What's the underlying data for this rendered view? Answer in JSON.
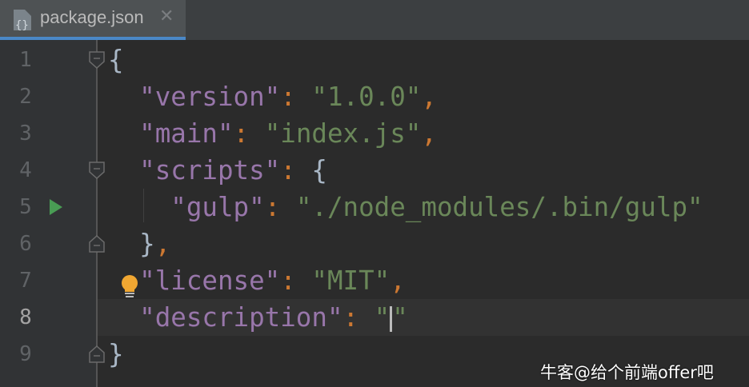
{
  "tab": {
    "title": "package.json",
    "icon": "json-file-icon",
    "close_icon": "close-icon",
    "close_glyph": "✕"
  },
  "line_numbers": [
    "1",
    "2",
    "3",
    "4",
    "5",
    "6",
    "7",
    "8",
    "9"
  ],
  "current_line": "8",
  "code": {
    "l1": {
      "brace": "{"
    },
    "l2": {
      "key": "\"version\"",
      "colon": ":",
      "value": "\"1.0.0\"",
      "comma": ","
    },
    "l3": {
      "key": "\"main\"",
      "colon": ":",
      "value": "\"index.js\"",
      "comma": ","
    },
    "l4": {
      "key": "\"scripts\"",
      "colon": ":",
      "brace": "{"
    },
    "l5": {
      "key": "\"gulp\"",
      "colon": ":",
      "value": "\"./node_modules/.bin/gulp\""
    },
    "l6": {
      "brace": "}",
      "comma": ","
    },
    "l7": {
      "key": "\"license\"",
      "colon": ":",
      "value": "\"MIT\"",
      "comma": ","
    },
    "l8": {
      "key": "\"description\"",
      "colon": ":",
      "value_open": "\"",
      "value_close": "\""
    },
    "l9": {
      "brace": "}"
    }
  },
  "watermark": "牛客@给个前端offer吧",
  "colors": {
    "key": "#9876aa",
    "string": "#6a8759",
    "punct": "#cc7832",
    "accent": "#4a88c7",
    "run": "#499c54",
    "bulb": "#f0a732"
  }
}
